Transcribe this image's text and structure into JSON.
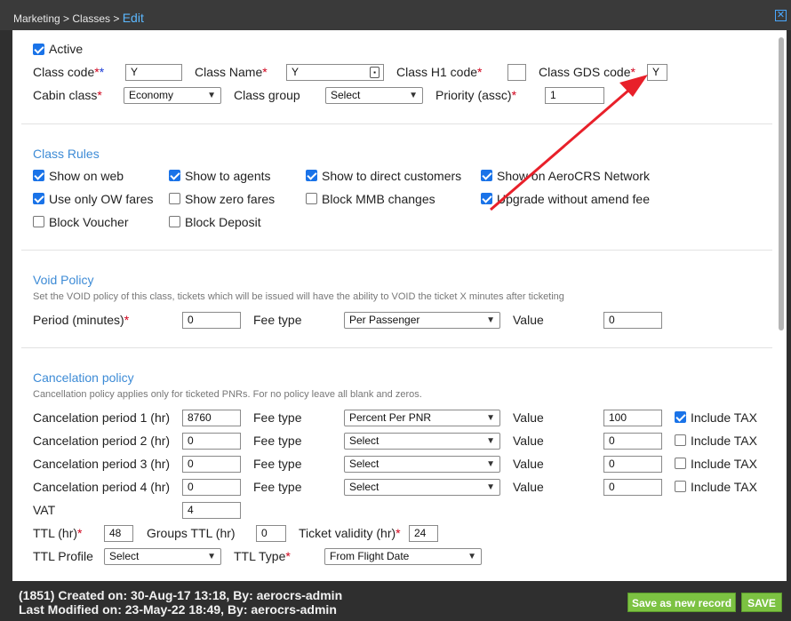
{
  "breadcrumb": {
    "path": "Marketing > Classes > ",
    "current": "Edit",
    "close_icon": "x-icon"
  },
  "general": {
    "active_label": "Active",
    "class_code_label": "Class code",
    "class_code_value": "Y",
    "class_name_label": "Class Name",
    "class_name_value": "Y",
    "class_h1_label": "Class H1 code",
    "class_h1_value": "",
    "class_gds_label": "Class GDS code",
    "class_gds_value": "Y",
    "cabin_class_label": "Cabin class",
    "cabin_class_value": "Economy",
    "class_group_label": "Class group",
    "class_group_value": "Select",
    "priority_label": "Priority (assc)",
    "priority_value": "1"
  },
  "class_rules": {
    "title": "Class Rules",
    "items": [
      {
        "label": "Show on web",
        "checked": true
      },
      {
        "label": "Show to agents",
        "checked": true
      },
      {
        "label": "Show to direct customers",
        "checked": true
      },
      {
        "label": "Show on AeroCRS Network",
        "checked": true
      },
      {
        "label": "Use only OW fares",
        "checked": true
      },
      {
        "label": "Show zero fares",
        "checked": false
      },
      {
        "label": "Block MMB changes",
        "checked": false
      },
      {
        "label": "Upgrade without amend fee",
        "checked": true
      },
      {
        "label": "Block Voucher",
        "checked": false
      },
      {
        "label": "Block Deposit",
        "checked": false
      }
    ]
  },
  "void_policy": {
    "title": "Void Policy",
    "desc": "Set the VOID policy of this class, tickets which will be issued will have the ability to VOID the ticket X minutes after ticketing",
    "period_label": "Period (minutes)",
    "period_value": "0",
    "fee_type_label": "Fee type",
    "fee_type_value": "Per Passenger",
    "value_label": "Value",
    "value_value": "0"
  },
  "cancelation_policy": {
    "title": "Cancelation policy",
    "desc": "Cancellation policy applies only for ticketed PNRs. For no policy leave all blank and zeros.",
    "fee_type_label": "Fee type",
    "value_label": "Value",
    "include_tax_label": "Include TAX",
    "rows": [
      {
        "label": "Cancelation period 1 (hr)",
        "period": "8760",
        "fee_type": "Percent Per PNR",
        "value": "100",
        "include_tax": true
      },
      {
        "label": "Cancelation period 2 (hr)",
        "period": "0",
        "fee_type": "Select",
        "value": "0",
        "include_tax": false
      },
      {
        "label": "Cancelation period 3 (hr)",
        "period": "0",
        "fee_type": "Select",
        "value": "0",
        "include_tax": false
      },
      {
        "label": "Cancelation period 4 (hr)",
        "period": "0",
        "fee_type": "Select",
        "value": "0",
        "include_tax": false
      }
    ],
    "vat_label": "VAT",
    "vat_value": "4"
  },
  "ttl": {
    "ttl_label": "TTL (hr)",
    "ttl_value": "48",
    "groups_ttl_label": "Groups TTL (hr)",
    "groups_ttl_value": "0",
    "ticket_validity_label": "Ticket validity (hr)",
    "ticket_validity_value": "24",
    "ttl_profile_label": "TTL Profile",
    "ttl_profile_value": "Select",
    "ttl_type_label": "TTL Type",
    "ttl_type_value": "From Flight Date"
  },
  "footer": {
    "created": "(1851) Created on: 30-Aug-17 13:18, By: aerocrs-admin",
    "modified": "Last Modified on: 23-May-22 18:49, By: aerocrs-admin",
    "save_as_new_label": "Save as new record",
    "save_label": "SAVE"
  },
  "colors": {
    "accent": "#3d8bd6",
    "checkbox": "#1a73e8",
    "required": "#d0021b",
    "save_button": "#7cc242",
    "annotation_arrow": "#e8202a"
  }
}
